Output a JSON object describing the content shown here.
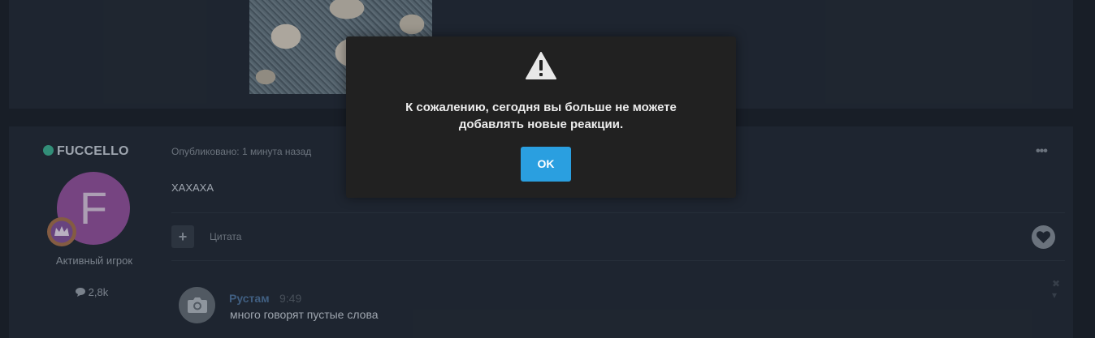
{
  "post": {
    "author": {
      "name": "FUCCELLO",
      "avatar_letter": "F",
      "avatar_color": "#8a4e95",
      "online_status_color": "#3aa58a",
      "role": "Активный игрок",
      "post_count": "2,8k",
      "post_count_icon": "speech-bubble-icon"
    },
    "published": "Опубликовано: 1 минута назад",
    "more_label": "•••",
    "content": "ХАХАХА",
    "actions": {
      "add_label": "+",
      "quote_label": "Цитата",
      "like_icon": "heart-icon"
    },
    "comment": {
      "author": "Рустам",
      "time": "9:49",
      "text": "много говорят пустые слова",
      "avatar_icon": "camera-icon",
      "close_label": "✖ ▾"
    }
  },
  "dialog": {
    "icon": "warning-icon",
    "message_line1": "К сожалению, сегодня вы больше не можете",
    "message_line2": "добавлять новые реакции.",
    "ok_label": "OK",
    "accent_color": "#2a9fe0"
  }
}
